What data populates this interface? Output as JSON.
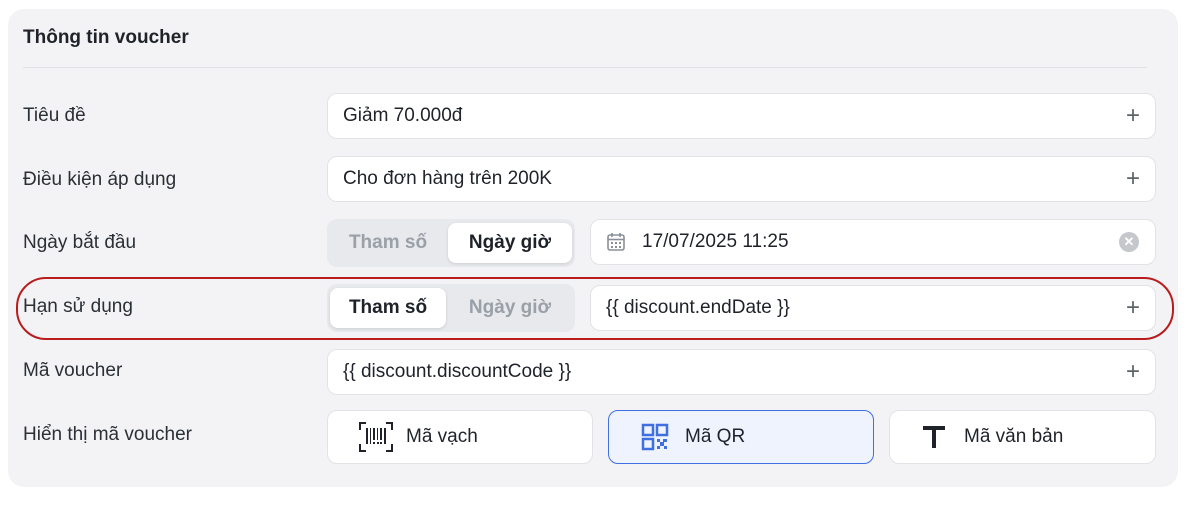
{
  "section": {
    "title": "Thông tin voucher"
  },
  "rows": {
    "title": {
      "label": "Tiêu đề",
      "value": "Giảm 70.000đ"
    },
    "condition": {
      "label": "Điều kiện áp dụng",
      "value": "Cho đơn hàng trên 200K"
    },
    "start_date": {
      "label": "Ngày bắt đầu",
      "seg_param": "Tham số",
      "seg_datetime": "Ngày giờ",
      "active": "Ngày giờ",
      "value": "17/07/2025 11:25"
    },
    "expiry": {
      "label": "Hạn sử dụng",
      "seg_param": "Tham số",
      "seg_datetime": "Ngày giờ",
      "active": "Tham số",
      "value": "{{ discount.endDate }}"
    },
    "code": {
      "label": "Mã voucher",
      "value": "{{ discount.discountCode }}"
    },
    "display": {
      "label": "Hiển thị mã voucher",
      "options": [
        {
          "label": "Mã vạch",
          "icon": "barcode-icon",
          "selected": false
        },
        {
          "label": "Mã QR",
          "icon": "qr-code-icon",
          "selected": true
        },
        {
          "label": "Mã văn bản",
          "icon": "text-icon",
          "selected": false
        }
      ]
    }
  },
  "colors": {
    "accent": "#3f6fe0",
    "highlight": "#b91c1c",
    "card_bg": "#f3f3f5"
  }
}
